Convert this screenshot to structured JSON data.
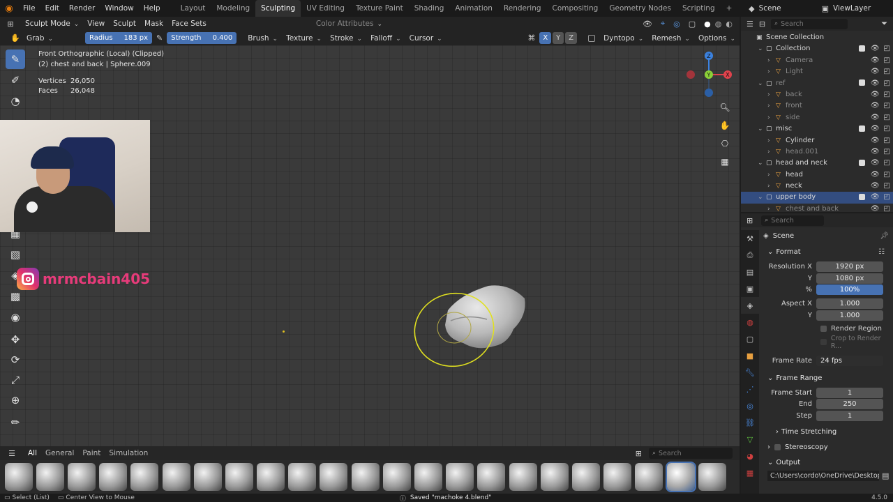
{
  "menubar": {
    "items": [
      "File",
      "Edit",
      "Render",
      "Window",
      "Help"
    ],
    "workspaces": [
      "Layout",
      "Modeling",
      "Sculpting",
      "UV Editing",
      "Texture Paint",
      "Shading",
      "Animation",
      "Rendering",
      "Compositing",
      "Geometry Nodes",
      "Scripting"
    ],
    "active_workspace": "Sculpting",
    "add_tab": "+",
    "scene": "Scene",
    "view_layer": "ViewLayer"
  },
  "header1": {
    "mode": "Sculpt Mode",
    "menus": [
      "View",
      "Sculpt",
      "Mask",
      "Face Sets"
    ],
    "color_attributes": "Color Attributes"
  },
  "header2": {
    "brush_name": "Grab",
    "radius_label": "Radius",
    "radius_value": "183 px",
    "strength_label": "Strength",
    "strength_value": "0.400",
    "menus": [
      "Brush",
      "Texture",
      "Stroke",
      "Falloff",
      "Cursor"
    ],
    "axis": [
      "X",
      "Y",
      "Z"
    ],
    "dyntopo": "Dyntopo",
    "remesh": "Remesh",
    "options": "Options"
  },
  "viewport": {
    "view_name": "Front Orthographic (Local) (Clipped)",
    "object_info": "(2) chest and back | Sphere.009",
    "stats": [
      {
        "label": "Vertices",
        "value": "26,050"
      },
      {
        "label": "Faces",
        "value": "26,048"
      }
    ],
    "watermark": "mrmcbain405",
    "gizmo_axes": {
      "x": "X",
      "y": "Y",
      "z": "Z"
    }
  },
  "shelf": {
    "tabs": [
      "All",
      "General",
      "Paint",
      "Simulation"
    ],
    "active_tab": "All",
    "search_placeholder": "Search",
    "brush_count": 23,
    "active_index": 21
  },
  "outliner": {
    "search_placeholder": "Search",
    "rows": [
      {
        "label": "Scene Collection",
        "depth": 0,
        "kind": "root"
      },
      {
        "label": "Collection",
        "depth": 1,
        "kind": "collection"
      },
      {
        "label": "Camera",
        "depth": 2,
        "kind": "object",
        "dim": true
      },
      {
        "label": "Light",
        "depth": 2,
        "kind": "object",
        "dim": true
      },
      {
        "label": "ref",
        "depth": 1,
        "kind": "collection",
        "dim": true
      },
      {
        "label": "back",
        "depth": 2,
        "kind": "object",
        "dim": true
      },
      {
        "label": "front",
        "depth": 2,
        "kind": "object",
        "dim": true
      },
      {
        "label": "side",
        "depth": 2,
        "kind": "object",
        "dim": true
      },
      {
        "label": "misc",
        "depth": 1,
        "kind": "collection"
      },
      {
        "label": "Cylinder",
        "depth": 2,
        "kind": "object"
      },
      {
        "label": "head.001",
        "depth": 2,
        "kind": "object",
        "dim": true
      },
      {
        "label": "head and neck",
        "depth": 1,
        "kind": "collection"
      },
      {
        "label": "head",
        "depth": 2,
        "kind": "object"
      },
      {
        "label": "neck",
        "depth": 2,
        "kind": "object"
      },
      {
        "label": "upper body",
        "depth": 1,
        "kind": "collection",
        "selected": true
      },
      {
        "label": "chest and back",
        "depth": 2,
        "kind": "object",
        "dim": true
      }
    ]
  },
  "properties": {
    "search_placeholder": "Search",
    "context": "Scene",
    "format_header": "Format",
    "resolution_x_label": "Resolution X",
    "resolution_x": "1920 px",
    "resolution_y_label": "Y",
    "resolution_y": "1080 px",
    "percent_label": "%",
    "percent": "100%",
    "aspect_x_label": "Aspect X",
    "aspect_x": "1.000",
    "aspect_y_label": "Y",
    "aspect_y": "1.000",
    "render_region": "Render Region",
    "crop_to_region": "Crop to Render R...",
    "frame_rate_label": "Frame Rate",
    "frame_rate": "24 fps",
    "frame_range_header": "Frame Range",
    "frame_start_label": "Frame Start",
    "frame_start": "1",
    "end_label": "End",
    "end": "250",
    "step_label": "Step",
    "step": "1",
    "time_stretching": "Time Stretching",
    "stereoscopy": "Stereoscopy",
    "output_header": "Output",
    "output_path": "C:\\Users\\cordo\\OneDrive\\Desktop\\"
  },
  "statusbar": {
    "left_hint": "Select (List)",
    "center_hint": "Center View to Mouse",
    "message": "Saved \"machoke 4.blend\"",
    "version": "4.5.0"
  },
  "colors": {
    "accent": "#4772b3",
    "brush_circle": "#e0e020",
    "axis_x": "#e0424c",
    "axis_y": "#8bd037",
    "axis_z": "#3b82e0",
    "instagram": "#e1306c"
  }
}
